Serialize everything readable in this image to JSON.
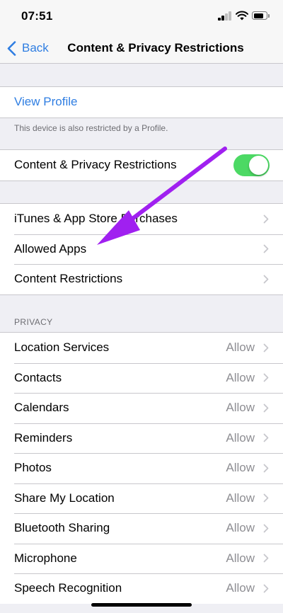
{
  "status_bar": {
    "time": "07:51"
  },
  "nav": {
    "back_label": "Back",
    "title": "Content & Privacy Restrictions"
  },
  "profile": {
    "link_label": "View Profile",
    "footer": "This device is also restricted by a Profile."
  },
  "restrictions_toggle": {
    "label": "Content & Privacy Restrictions",
    "on": true
  },
  "store_group": {
    "items": [
      {
        "label": "iTunes & App Store Purchases"
      },
      {
        "label": "Allowed Apps"
      },
      {
        "label": "Content Restrictions"
      }
    ]
  },
  "privacy": {
    "header": "PRIVACY",
    "items": [
      {
        "label": "Location Services",
        "value": "Allow"
      },
      {
        "label": "Contacts",
        "value": "Allow"
      },
      {
        "label": "Calendars",
        "value": "Allow"
      },
      {
        "label": "Reminders",
        "value": "Allow"
      },
      {
        "label": "Photos",
        "value": "Allow"
      },
      {
        "label": "Share My Location",
        "value": "Allow"
      },
      {
        "label": "Bluetooth Sharing",
        "value": "Allow"
      },
      {
        "label": "Microphone",
        "value": "Allow"
      },
      {
        "label": "Speech Recognition",
        "value": "Allow"
      }
    ]
  },
  "colors": {
    "accent": "#2f7ee2",
    "toggle_on": "#4cd964",
    "annotation_arrow": "#a020f0"
  }
}
